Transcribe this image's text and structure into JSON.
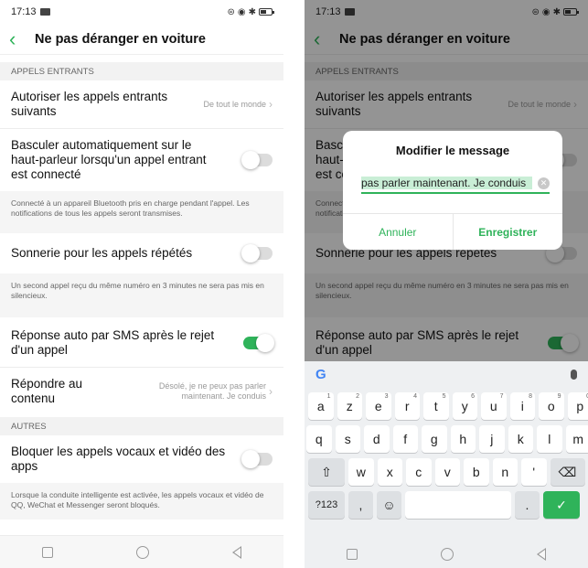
{
  "status": {
    "time": "17:13"
  },
  "header": {
    "title": "Ne pas déranger en voiture"
  },
  "sections": {
    "incoming": "APPELS ENTRANTS",
    "others": "AUTRES"
  },
  "settings": {
    "allow_calls": {
      "label": "Autoriser les appels entrants suivants",
      "value": "De tout le monde"
    },
    "speaker": {
      "label": "Basculer automatiquement sur le haut-parleur lorsqu'un appel entrant est connecté",
      "toggle": false
    },
    "speaker_desc": "Connecté à un appareil Bluetooth pris en charge pendant l'appel. Les notifications de tous les appels seront transmises.",
    "repeat": {
      "label": "Sonnerie pour les appels répétés",
      "toggle": false
    },
    "repeat_desc": "Un second appel reçu du même numéro en 3 minutes ne sera pas mis en silencieux.",
    "sms_reply": {
      "label": "Réponse auto par SMS après le rejet d'un appel",
      "toggle": true
    },
    "reply_content": {
      "label": "Répondre au contenu",
      "value": "Désolé, je ne peux pas parler maintenant. Je conduis"
    },
    "block_voip": {
      "label": "Bloquer les appels vocaux et vidéo des apps",
      "toggle": false
    },
    "block_voip_desc": "Lorsque la conduite intelligente est activée, les appels vocaux et vidéo de QQ, WeChat et Messenger seront bloqués."
  },
  "dialog": {
    "title": "Modifier le message",
    "input_value": "pas parler maintenant. Je conduis",
    "cancel": "Annuler",
    "save": "Enregistrer"
  },
  "keyboard": {
    "row1": [
      {
        "k": "a",
        "n": "1"
      },
      {
        "k": "z",
        "n": "2"
      },
      {
        "k": "e",
        "n": "3"
      },
      {
        "k": "r",
        "n": "4"
      },
      {
        "k": "t",
        "n": "5"
      },
      {
        "k": "y",
        "n": "6"
      },
      {
        "k": "u",
        "n": "7"
      },
      {
        "k": "i",
        "n": "8"
      },
      {
        "k": "o",
        "n": "9"
      },
      {
        "k": "p",
        "n": "0"
      }
    ],
    "row2": [
      "q",
      "s",
      "d",
      "f",
      "g",
      "h",
      "j",
      "k",
      "l",
      "m"
    ],
    "row3": [
      "w",
      "x",
      "c",
      "v",
      "b",
      "n",
      "'"
    ],
    "sym": "?123",
    "comma": ",",
    "period": "."
  },
  "colors": {
    "accent": "#2fb35a"
  }
}
